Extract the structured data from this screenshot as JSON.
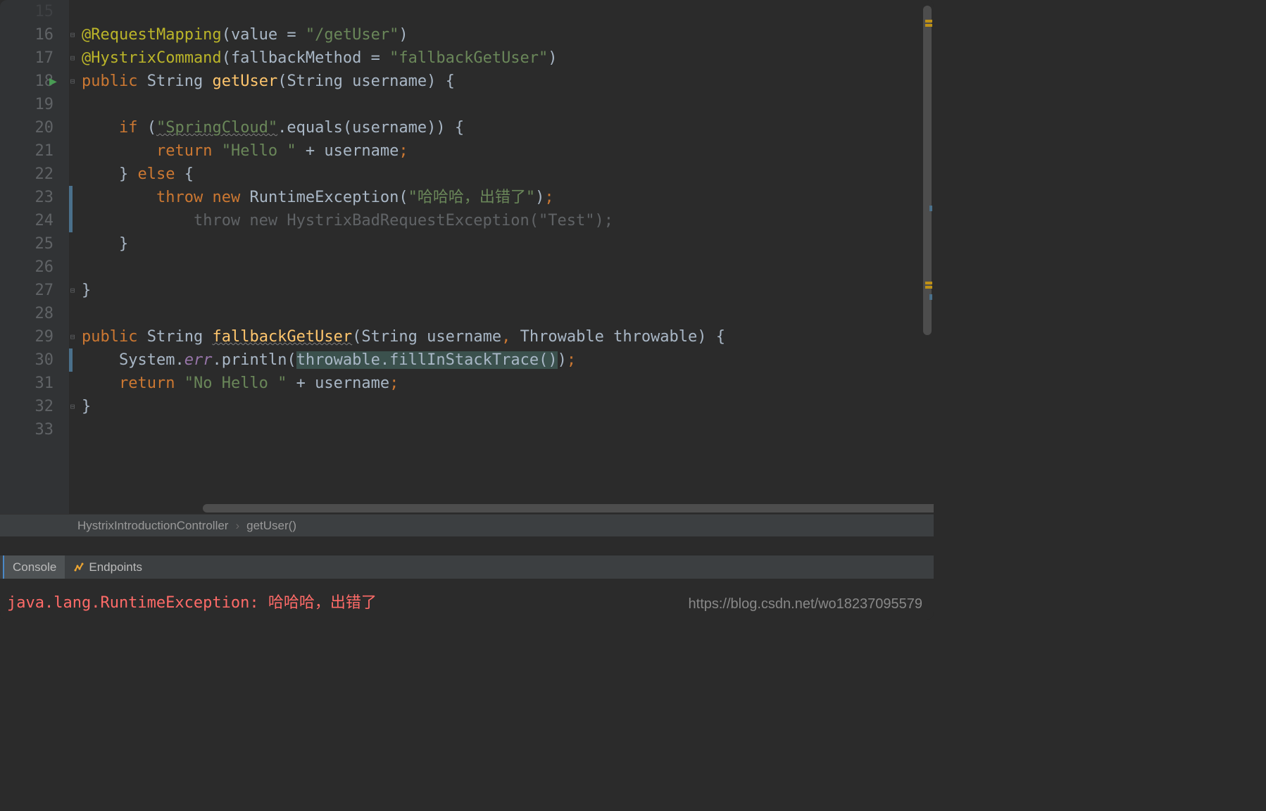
{
  "line_numbers": [
    "15",
    "16",
    "17",
    "18",
    "19",
    "20",
    "21",
    "22",
    "23",
    "24",
    "25",
    "26",
    "27",
    "28",
    "29",
    "30",
    "31",
    "32",
    "33"
  ],
  "code": {
    "l16": {
      "anno": "@RequestMapping",
      "p1": "(",
      "attr": "value",
      "eq": " = ",
      "str": "\"/getUser\"",
      "p2": ")"
    },
    "l17": {
      "anno": "@HystrixCommand",
      "p1": "(",
      "attr": "fallbackMethod",
      "eq": " = ",
      "str": "\"fallbackGetUser\"",
      "p2": ")"
    },
    "l18": {
      "kw1": "public",
      "sp1": " ",
      "type": "String",
      "sp2": " ",
      "method": "getUser",
      "p1": "(",
      "ptype": "String",
      "sp3": " ",
      "param": "username",
      "p2": ")",
      "sp4": " ",
      "brace": "{"
    },
    "l20": {
      "kw": "if",
      "sp": " ",
      "p1": "(",
      "str": "\"SpringCloud\"",
      "dot": ".",
      "m": "equals",
      "p2": "(",
      "arg": "username",
      "p3": ")",
      "p4": ")",
      "sp2": " ",
      "brace": "{"
    },
    "l21": {
      "kw": "return",
      "sp": " ",
      "str": "\"Hello \"",
      "sp2": " ",
      "op": "+",
      "sp3": " ",
      "v": "username",
      "semi": ";"
    },
    "l22": {
      "brace1": "}",
      "sp": " ",
      "kw": "else",
      "sp2": " ",
      "brace2": "{"
    },
    "l23": {
      "kw1": "throw",
      "sp": " ",
      "kw2": "new",
      "sp2": " ",
      "cls": "RuntimeException",
      "p1": "(",
      "str": "\"哈哈哈，出错了\"",
      "p2": ")",
      "semi": ";"
    },
    "l24": {
      "text": "throw new HystrixBadRequestException(\"Test\");"
    },
    "l25": {
      "brace": "}"
    },
    "l27": {
      "brace": "}"
    },
    "l29": {
      "kw1": "public",
      "sp1": " ",
      "type": "String",
      "sp2": " ",
      "method": "fallbackGetUser",
      "p1": "(",
      "ptype1": "String",
      "sp3": " ",
      "param1": "username",
      "comma": ",",
      "sp4": " ",
      "ptype2": "Throwable",
      "sp5": " ",
      "param2": "throwable",
      "p2": ")",
      "sp6": " ",
      "brace": "{"
    },
    "l30": {
      "cls": "System",
      "dot1": ".",
      "field": "err",
      "dot2": ".",
      "m": "println",
      "p1": "(",
      "arg1": "throwable",
      "dot3": ".",
      "m2": "fillInStackTrace",
      "p2": "(",
      "p3": ")",
      "p4": ")",
      "semi": ";"
    },
    "l31": {
      "kw": "return",
      "sp": " ",
      "str": "\"No Hello \"",
      "sp2": " ",
      "op": "+",
      "sp3": " ",
      "v": "username",
      "semi": ";"
    },
    "l32": {
      "brace": "}"
    }
  },
  "breadcrumb": {
    "class": "HystrixIntroductionController",
    "method": "getUser()"
  },
  "tabs": {
    "console": "Console",
    "endpoints": "Endpoints"
  },
  "console_output": "java.lang.RuntimeException: 哈哈哈，出错了",
  "watermark": "https://blog.csdn.net/wo18237095579"
}
